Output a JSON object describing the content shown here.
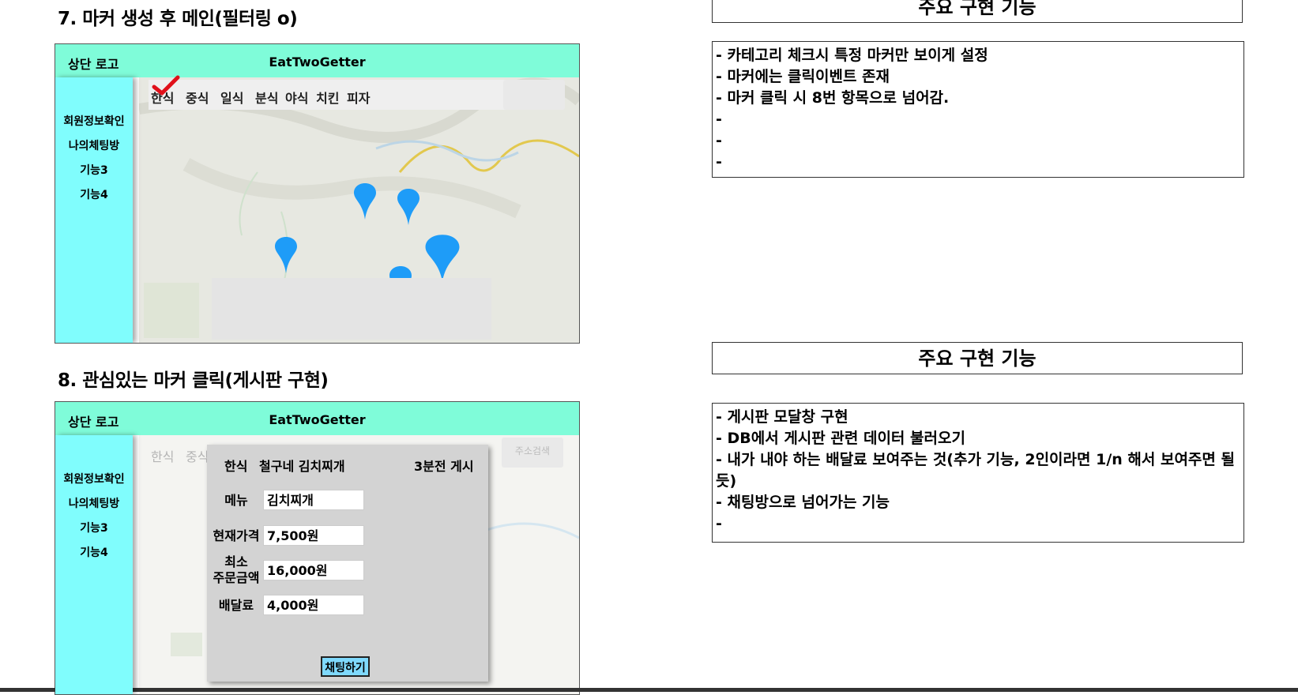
{
  "section7": {
    "title": "7. 마커 생성 후 메인(필터링 o)",
    "mock": {
      "logo": "상단 로고",
      "app_title": "EatTwoGetter",
      "sidebar": [
        "회원정보확인",
        "나의체팅방",
        "기능3",
        "기능4"
      ],
      "categories": [
        "한식",
        "중식",
        "일식",
        "분식",
        "야식",
        "치킨",
        "피자"
      ],
      "checked_category": "한식"
    },
    "panel": {
      "heading": "주요 구현 기능",
      "lines": [
        "- 카테고리 체크시 특정 마커만 보이게 설정",
        "- 마커에는 클릭이벤트 존재",
        "- 마커 클릭 시 8번 항목으로 넘어감.",
        "-",
        "-",
        "-"
      ]
    }
  },
  "section8": {
    "title": "8. 관심있는 마커 클릭(게시판 구현)",
    "mock": {
      "logo": "상단 로고",
      "app_title": "EatTwoGetter",
      "sidebar": [
        "회원정보확인",
        "나의체팅방",
        "기능3",
        "기능4"
      ],
      "categories_faded": [
        "한식",
        "중식"
      ],
      "search_label": "주소검색",
      "modal": {
        "category": "한식",
        "restaurant": "철구네 김치찌개",
        "posted": "3분전 게시",
        "menu_label": "메뉴",
        "menu_value": "김치찌개",
        "price_label": "현재가격",
        "price_value": "7,500원",
        "min_order_label_1": "최소",
        "min_order_label_2": "주문금액",
        "min_order_value": "16,000원",
        "delivery_label": "배달료",
        "delivery_value": "4,000원",
        "chat_button": "채팅하기"
      }
    },
    "panel": {
      "heading": "주요 구현 기능",
      "lines": [
        "- 게시판 모달창 구현",
        "- DB에서 게시판 관련 데이터 불러오기",
        "- 내가 내야 하는 배달료 보여주는 것(추가 기능, 2인이라면 1/n 해서 보여주면 될 듯)",
        "- 채팅방으로 넘어가는 기능",
        "-"
      ]
    }
  },
  "colors": {
    "header_bg": "#7ffcd9",
    "sidebar_bg": "#80fdfd",
    "marker": "#1e9cf8",
    "check": "#e0101a",
    "chat_button": "#7fd9fd"
  }
}
